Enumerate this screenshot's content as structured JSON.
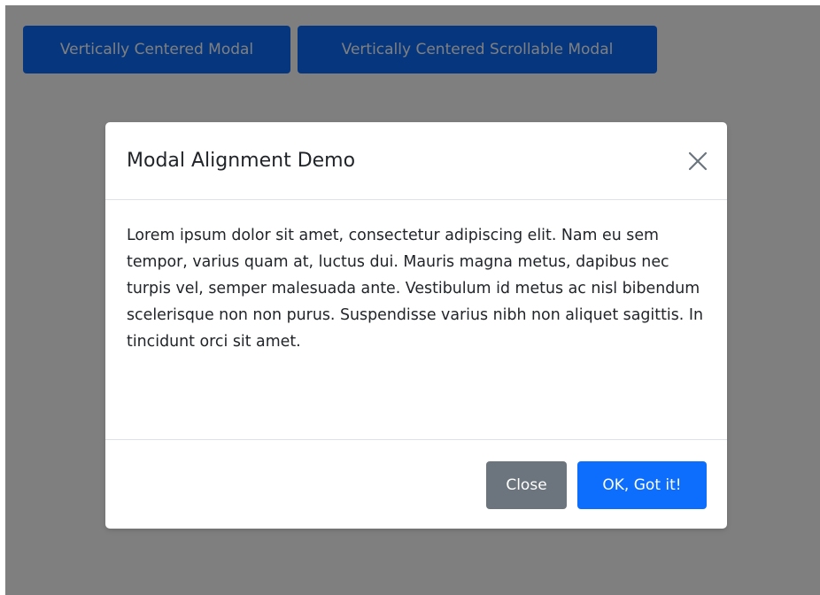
{
  "page": {
    "buttons": [
      {
        "label": "Vertically Centered Modal"
      },
      {
        "label": "Vertically Centered Scrollable Modal"
      }
    ]
  },
  "modal": {
    "title": "Modal Alignment Demo",
    "close_icon": "close-x-icon",
    "body_text": "Lorem ipsum dolor sit amet, consectetur adipiscing elit. Nam eu sem tempor, varius quam at, luctus dui. Mauris magna metus, dapibus nec turpis vel, semper malesuada ante. Vestibulum id metus ac nisl bibendum scelerisque non non purus. Suspendisse varius nibh non aliquet sagittis. In tincidunt orci sit amet.",
    "footer": {
      "close_label": "Close",
      "ok_label": "OK, Got it!"
    }
  },
  "colors": {
    "primary": "#0d6efd",
    "secondary": "#6c757d",
    "backdrop": "rgba(0,0,0,0.5)"
  }
}
